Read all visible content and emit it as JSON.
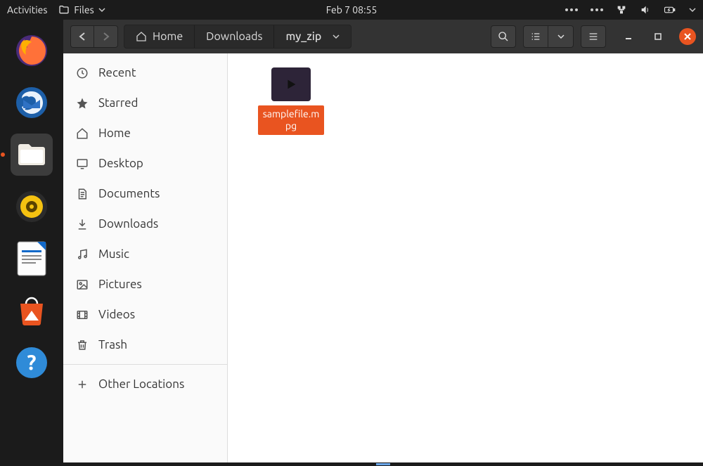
{
  "topbar": {
    "activities": "Activities",
    "files_label": "Files",
    "clock": "Feb 7  08:55"
  },
  "titlebar": {
    "path": [
      {
        "label": "Home",
        "has_home_icon": true
      },
      {
        "label": "Downloads"
      },
      {
        "label": "my_zip",
        "current": true
      }
    ]
  },
  "sidebar": {
    "items": [
      {
        "icon": "recent",
        "label": "Recent"
      },
      {
        "icon": "star",
        "label": "Starred"
      },
      {
        "icon": "home",
        "label": "Home"
      },
      {
        "icon": "desktop",
        "label": "Desktop"
      },
      {
        "icon": "documents",
        "label": "Documents"
      },
      {
        "icon": "downloads",
        "label": "Downloads"
      },
      {
        "icon": "music",
        "label": "Music"
      },
      {
        "icon": "pictures",
        "label": "Pictures"
      },
      {
        "icon": "videos",
        "label": "Videos"
      },
      {
        "icon": "trash",
        "label": "Trash"
      }
    ],
    "other_locations": "Other Locations"
  },
  "content": {
    "files": [
      {
        "name": "samplefile.mpg",
        "type": "video",
        "selected": true
      }
    ]
  },
  "colors": {
    "accent": "#e95420",
    "titlebar": "#333333",
    "sidebar": "#fafafa"
  }
}
